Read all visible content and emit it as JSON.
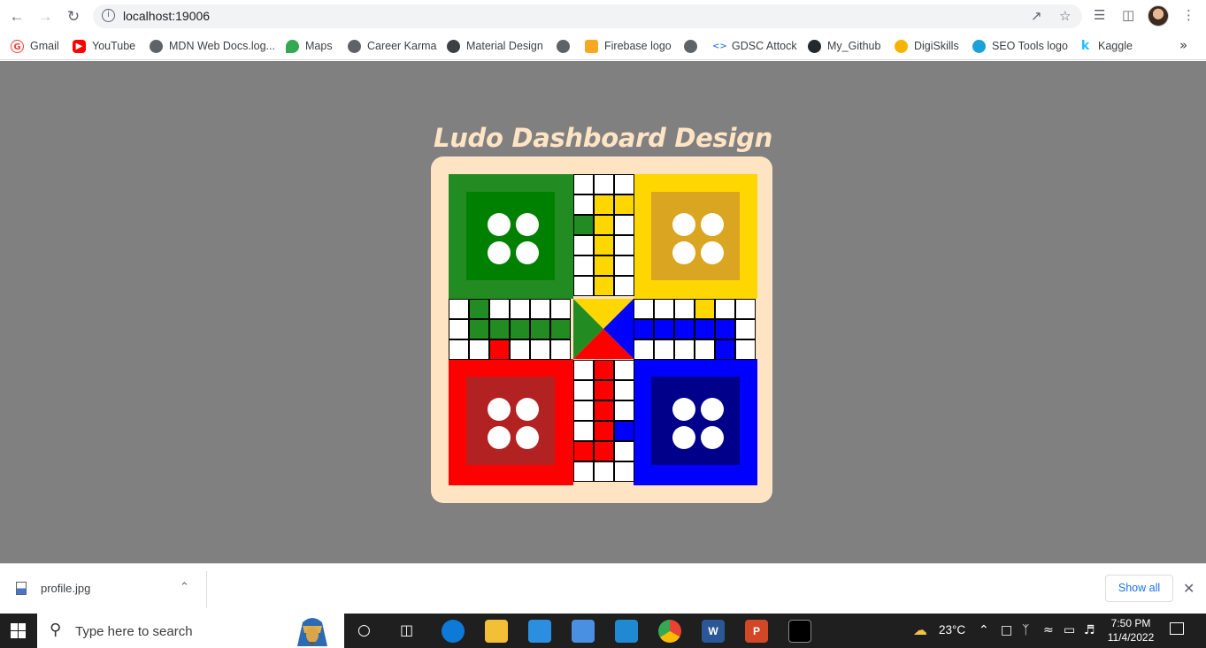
{
  "browser": {
    "url": "localhost:19006",
    "bookmarks": [
      {
        "label": "Gmail",
        "icon": "gmail-icon",
        "color": "#ea4335"
      },
      {
        "label": "YouTube",
        "icon": "youtube-icon",
        "color": "#ff0000"
      },
      {
        "label": "MDN Web Docs.log...",
        "icon": "globe-icon",
        "color": "#5f6368"
      },
      {
        "label": "Maps",
        "icon": "maps-pin-icon",
        "color": "#34a853"
      },
      {
        "label": "Career Karma",
        "icon": "globe-icon",
        "color": "#5f6368"
      },
      {
        "label": "Material Design",
        "icon": "material-icon",
        "color": "#3c4043"
      },
      {
        "label": "",
        "icon": "globe-icon",
        "color": "#5f6368"
      },
      {
        "label": "Firebase logo",
        "icon": "firebase-icon",
        "color": "#f6a821"
      },
      {
        "label": "",
        "icon": "globe-icon",
        "color": "#5f6368"
      },
      {
        "label": "GDSC Attock",
        "icon": "gdsc-icon",
        "color": "#4285f4"
      },
      {
        "label": "My_Github",
        "icon": "github-icon",
        "color": "#24292e"
      },
      {
        "label": "DigiSkills",
        "icon": "digiskills-icon",
        "color": "#f5b400"
      },
      {
        "label": "SEO Tools logo",
        "icon": "seo-icon",
        "color": "#1aa1d6"
      },
      {
        "label": "Kaggle",
        "icon": "kaggle-icon",
        "color": "#20beff"
      }
    ]
  },
  "page": {
    "title": "Ludo Dashboard Design",
    "colors": {
      "background": "#808080",
      "frame": "#ffe4c4",
      "green": "#228b22",
      "green_inner": "#008000",
      "yellow": "#ffd700",
      "yellow_inner": "#daa520",
      "red": "#ff0000",
      "red_inner": "#b22222",
      "blue": "#0000ff",
      "blue_inner": "#00008b"
    }
  },
  "downloads": {
    "file_name": "profile.jpg",
    "show_all": "Show all"
  },
  "taskbar": {
    "search_placeholder": "Type here to search",
    "weather": "23°C",
    "time": "7:50 PM",
    "date": "11/4/2022"
  }
}
